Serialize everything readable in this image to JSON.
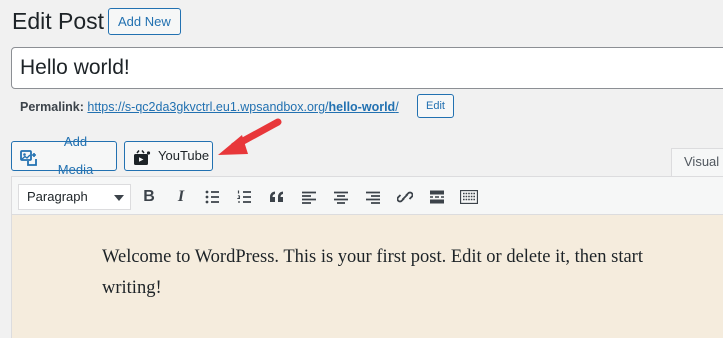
{
  "header": {
    "title": "Edit Post",
    "add_new_label": "Add New"
  },
  "post": {
    "title_value": "Hello world!",
    "permalink_label": "Permalink:",
    "permalink_base": "https://s-qc2da3gkvctrl.eu1.wpsandbox.org/",
    "permalink_slug": "hello-world",
    "permalink_trailing": "/",
    "edit_slug_label": "Edit"
  },
  "media_buttons": {
    "add_media_label": "Add Media",
    "youtube_label": "YouTube"
  },
  "editor": {
    "tab_visual_label": "Visual",
    "format_selected": "Paragraph",
    "toolbar_icons": [
      "bold-icon",
      "italic-icon",
      "bulleted-list-icon",
      "numbered-list-icon",
      "blockquote-icon",
      "align-left-icon",
      "align-center-icon",
      "align-right-icon",
      "insert-link-icon",
      "read-more-icon",
      "toolbar-toggle-icon"
    ],
    "bold_glyph": "B",
    "italic_glyph": "I",
    "content_text": "Welcome to WordPress. This is your first post. Edit or delete it, then start writing!",
    "content_bg": "#f5ecdd"
  },
  "annotation": {
    "arrow_color": "#e8373a"
  }
}
